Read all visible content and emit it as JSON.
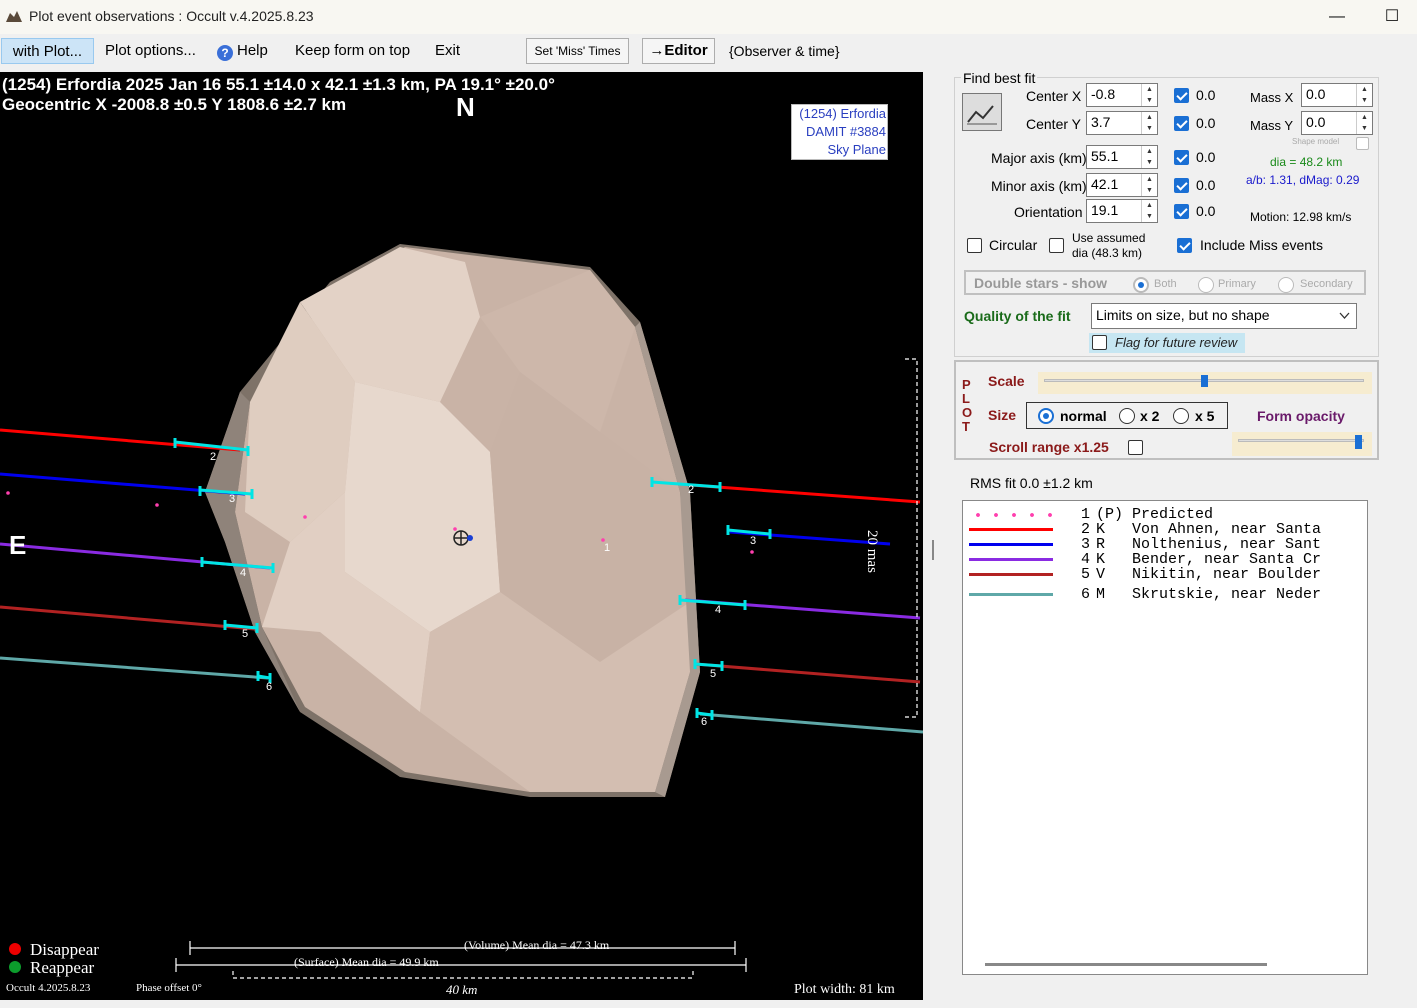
{
  "window": {
    "title": "Plot event observations : Occult v.4.2025.8.23",
    "minimize": "—",
    "maximize": "☐"
  },
  "menu": {
    "with_plot": "with Plot...",
    "plot_options": "Plot options...",
    "help": "Help",
    "keep_on_top": "Keep form on top",
    "exit": "Exit",
    "set_miss_times": "Set 'Miss' Times",
    "editor": "→Editor",
    "observer_time": "{Observer & time}"
  },
  "plot": {
    "header1": "(1254) Erfordia  2025 Jan 16   55.1 ±14.0 x 42.1 ±1.3 km, PA 19.1° ±20.0°",
    "header2": "Geocentric  X  -2008.8 ±0.5  Y 1808.6 ±2.7 km",
    "north": "N",
    "east": "E",
    "id_box": [
      "(1254) Erfordia",
      "DAMIT #3884",
      "Sky Plane"
    ],
    "scale_mas": "20 mas",
    "disappear": "Disappear",
    "reappear": "Reappear",
    "volume_dia": "(Volume) Mean dia = 47.3 km",
    "surface_dia": "(Surface) Mean dia = 49.9 km",
    "scale_km": "40 km",
    "version": "Occult 4.2025.8.23",
    "phase": "Phase offset 0°",
    "plot_width": "Plot width: 81 km",
    "chord_labels": [
      "1",
      "2",
      "3",
      "4",
      "5",
      "6"
    ]
  },
  "fit": {
    "find_best_fit": "Find best fit",
    "center_x_label": "Center X",
    "center_x": "-0.8",
    "center_x_chk": "0.0",
    "center_y_label": "Center Y",
    "center_y": "3.7",
    "center_y_chk": "0.0",
    "mass_x_label": "Mass X",
    "mass_x": "0.0",
    "mass_y_label": "Mass Y",
    "mass_y": "0.0",
    "shape_model": "Shape model",
    "major_label": "Major axis (km)",
    "major": "55.1",
    "major_chk": "0.0",
    "minor_label": "Minor axis (km)",
    "minor": "42.1",
    "minor_chk": "0.0",
    "orient_label": "Orientation",
    "orient": "19.1",
    "orient_chk": "0.0",
    "dia": "dia = 48.2 km",
    "ab": "a/b: 1.31, dMag: 0.29",
    "motion": "Motion: 12.98 km/s",
    "circular": "Circular",
    "use_assumed": "Use assumed",
    "use_assumed2": "dia (48.3 km)",
    "include_miss": "Include Miss events",
    "double_stars": "Double stars - show",
    "both": "Both",
    "primary": "Primary",
    "secondary": "Secondary",
    "quality_label": "Quality of the fit",
    "quality_value": "Limits on size, but no shape",
    "flag_review": "Flag for future review"
  },
  "plotbox": {
    "vert": "PLOT",
    "scale": "Scale",
    "size": "Size",
    "normal": "normal",
    "x2": "x 2",
    "x5": "x 5",
    "form_opacity": "Form opacity",
    "scroll_range": "Scroll range x1.25",
    "scale_value": 0.5,
    "opacity_value": 0.95
  },
  "rms": "RMS fit 0.0 ±1.2 km",
  "legend": [
    {
      "num": "1",
      "code": "(P)",
      "name": "Predicted",
      "color": "#ff3fae",
      "style": "dots"
    },
    {
      "num": "2",
      "code": "K",
      "name": "Von Ahnen, near Santa",
      "color": "#ff0000",
      "style": "line"
    },
    {
      "num": "3",
      "code": "R",
      "name": "Nolthenius, near Sant",
      "color": "#0000ee",
      "style": "line"
    },
    {
      "num": "4",
      "code": "K",
      "name": "Bender, near Santa Cr",
      "color": "#8a2be2",
      "style": "line"
    },
    {
      "num": "5",
      "code": "V",
      "name": "Nikitin, near Boulder",
      "color": "#b22222",
      "style": "line"
    },
    {
      "num": "6",
      "code": "M",
      "name": "Skrutskie, near Neder",
      "color": "#5fa8a8",
      "style": "line"
    }
  ]
}
